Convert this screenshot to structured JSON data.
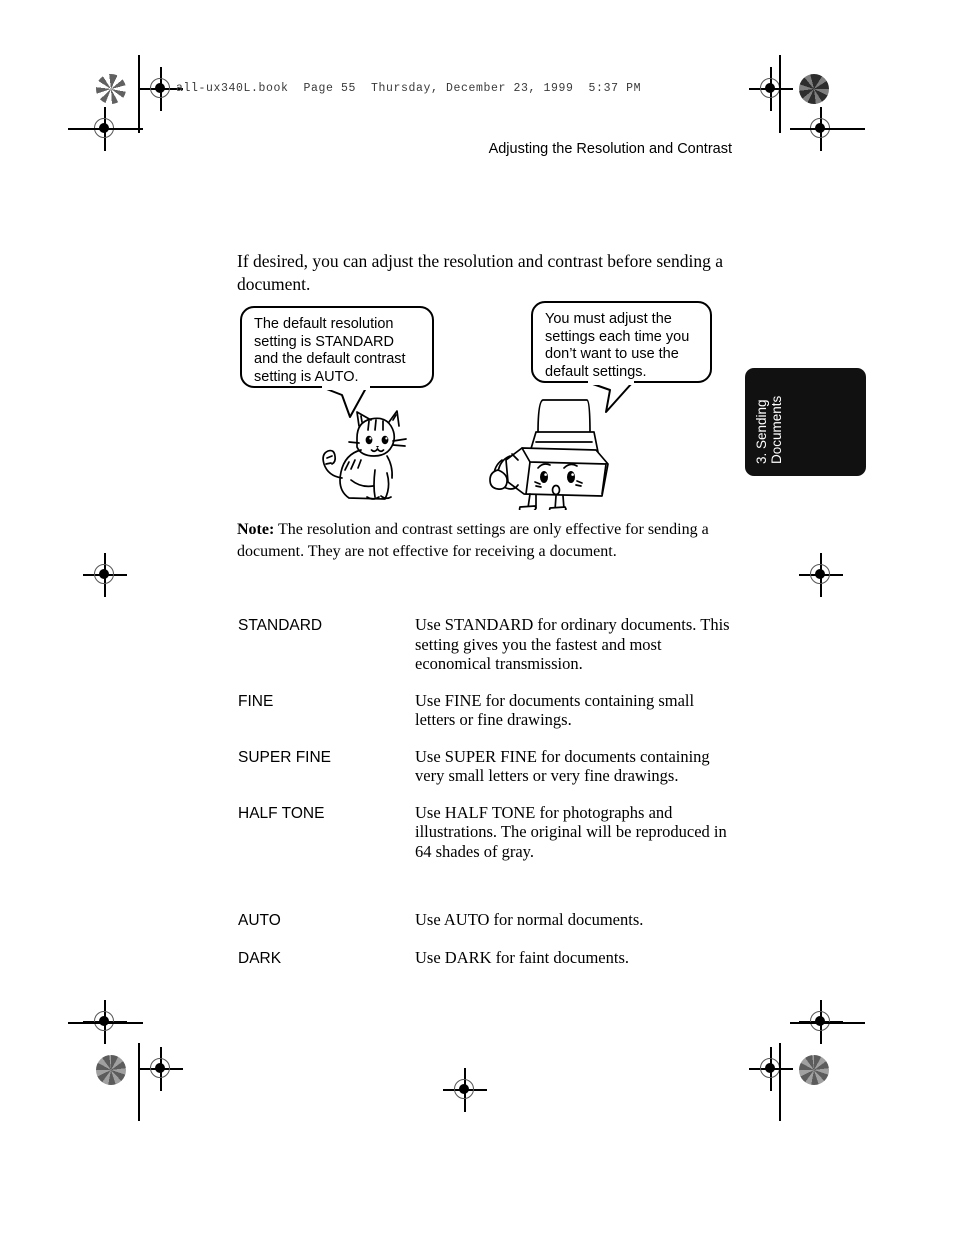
{
  "page": {
    "book_stamp": "all-ux340L.book  Page 55  Thursday, December 23, 1999  5:37 PM",
    "running_head": "Adjusting the Resolution and Contrast",
    "page_number": "55"
  },
  "side_tab": {
    "label": "3. Sending\nDocuments",
    "background_color": "#111111",
    "text_color": "#ffffff"
  },
  "body": {
    "intro": "If desired, you can adjust the resolution and contrast before sending a document.",
    "note_label": "Note:",
    "note_text": " The resolution and contrast settings are only effective for sending a document. They are not effective for receiving a document."
  },
  "bubbles": [
    {
      "id": "resolution-default-bubble",
      "text": "The default resolution setting is STANDARD and the default contrast setting is AUTO."
    },
    {
      "id": "adjust-settings-bubble",
      "text": "You must adjust the settings each time you don’t want to use the default settings."
    }
  ],
  "illustrations": [
    {
      "id": "cat-illustration",
      "name": "line-art cat character"
    },
    {
      "id": "fax-machine-illustration",
      "name": "cartoon fax machine character with face"
    }
  ],
  "resolution_settings": [
    {
      "term": "STANDARD",
      "description": "Use STANDARD for ordinary documents. This setting gives you the fastest and most economical transmission."
    },
    {
      "term": "FINE",
      "description": "Use FINE for documents containing small letters or fine drawings."
    },
    {
      "term": "SUPER FINE",
      "description": "Use SUPER FINE for documents containing very small letters or very fine drawings."
    },
    {
      "term": "HALF TONE",
      "description": "Use HALF TONE for photographs and illustrations. The original will be reproduced in 64 shades of gray."
    }
  ],
  "contrast_settings": [
    {
      "term": "AUTO",
      "description": "Use AUTO for normal documents."
    },
    {
      "term": "DARK",
      "description": "Use DARK for faint documents."
    }
  ]
}
